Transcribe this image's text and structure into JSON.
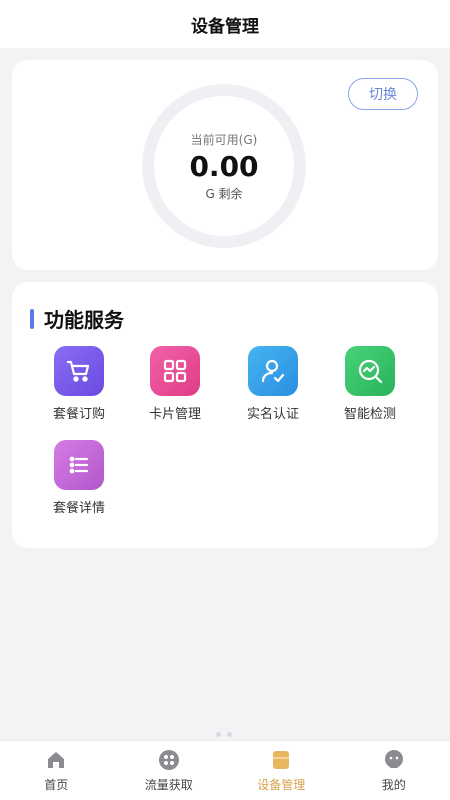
{
  "header": {
    "title": "设备管理"
  },
  "usage": {
    "switch_label": "切换",
    "ring_label": "当前可用(G)",
    "value": "0.00",
    "sub_label": "G 剩余"
  },
  "services": {
    "title": "功能服务",
    "items": [
      {
        "label": "套餐订购",
        "icon": "cart-icon",
        "color": "#7b5cf0"
      },
      {
        "label": "卡片管理",
        "icon": "grid-icon",
        "color": "#e8509a"
      },
      {
        "label": "实名认证",
        "icon": "user-check-icon",
        "color": "#3aa0ea"
      },
      {
        "label": "智能检测",
        "icon": "detect-icon",
        "color": "#39c46a"
      },
      {
        "label": "套餐详情",
        "icon": "list-icon",
        "color": "#c66ad8"
      }
    ]
  },
  "tabbar": {
    "items": [
      {
        "label": "首页",
        "icon": "home-icon"
      },
      {
        "label": "流量获取",
        "icon": "apps-icon"
      },
      {
        "label": "设备管理",
        "icon": "device-icon",
        "active": true
      },
      {
        "label": "我的",
        "icon": "profile-icon"
      }
    ]
  }
}
